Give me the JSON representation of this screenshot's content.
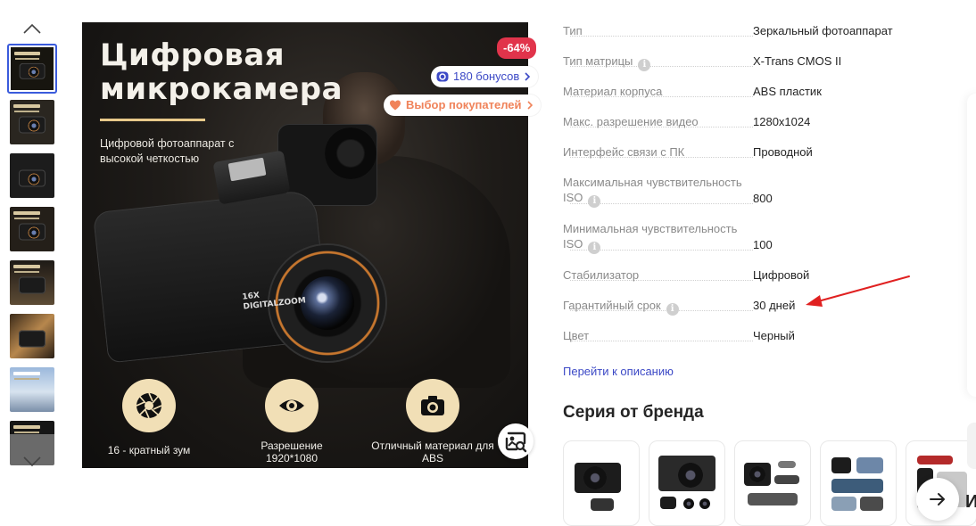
{
  "thumbnails": {
    "count": 8,
    "active_index": 0
  },
  "hero": {
    "title_line1": "Цифровая",
    "title_line2": "микрокамера",
    "subtitle": "Цифровой фотоаппарат с высокой четкостью",
    "camera_label_line1": "16X",
    "camera_label_line2": "DIGITALZOOM",
    "features": [
      {
        "label": "16 - кратный зум",
        "icon": "aperture-icon"
      },
      {
        "label": "Разрешение 1920*1080",
        "icon": "eye-icon"
      },
      {
        "label": "Отличный материал для ABS",
        "icon": "camera-icon"
      }
    ]
  },
  "badges": {
    "discount": "-64%",
    "bonus": "180 бонусов",
    "choice": "Выбор покупателей"
  },
  "specs": [
    {
      "label": "Тип",
      "value": "Зеркальный фотоаппарат",
      "info": false
    },
    {
      "label": "Тип матрицы",
      "value": "X-Trans CMOS II",
      "info": true
    },
    {
      "label": "Материал корпуса",
      "value": "ABS пластик",
      "info": false
    },
    {
      "label": "Макс. разрешение видео",
      "value": "1280x1024",
      "info": false
    },
    {
      "label": "Интерфейс связи с ПК",
      "value": "Проводной",
      "info": false
    },
    {
      "label_line1": "Максимальная чувствительность",
      "label_line2": "ISO",
      "value": "800",
      "info": true
    },
    {
      "label_line1": "Минимальная чувствительность",
      "label_line2": "ISO",
      "value": "100",
      "info": true
    },
    {
      "label": "Стабилизатор",
      "value": "Цифровой",
      "info": false
    },
    {
      "label": "Гарантийный срок",
      "value": "30 дней",
      "info": true
    },
    {
      "label": "Цвет",
      "value": "Черный",
      "info": false
    }
  ],
  "goto_description": "Перейти к описанию",
  "series": {
    "title": "Серия от бренда",
    "card_count": 5,
    "next_partial_letter": "И"
  },
  "colors": {
    "accent_blue": "#3c49c6",
    "discount_red": "#e1344b",
    "choice_orange": "#f0835a",
    "annotation_red": "#e02020",
    "feature_gold": "#f1dfb6"
  }
}
